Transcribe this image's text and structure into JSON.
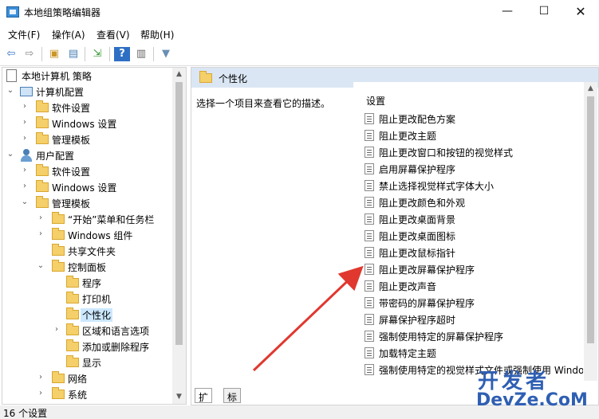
{
  "window": {
    "title": "本地组策略编辑器",
    "minimize": "—",
    "maximize": "☐",
    "close": "✕"
  },
  "menu": [
    "文件(F)",
    "操作(A)",
    "查看(V)",
    "帮助(H)"
  ],
  "toolbar": {
    "back": "⇦",
    "forward": "⇨",
    "up": "▣",
    "show_hide": "▤",
    "export": "⇲",
    "help": "?",
    "properties": "▥",
    "filter": "▼"
  },
  "tree": {
    "root": "本地计算机 策略",
    "computer_config": "计算机配置",
    "cc_software": "软件设置",
    "cc_windows": "Windows 设置",
    "cc_admin": "管理模板",
    "user_config": "用户配置",
    "uc_software": "软件设置",
    "uc_windows": "Windows 设置",
    "uc_admin": "管理模板",
    "start_menu": "“开始”菜单和任务栏",
    "windows_components": "Windows 组件",
    "shared_folders": "共享文件夹",
    "control_panel": "控制面板",
    "programs": "程序",
    "printers": "打印机",
    "personalization": "个性化",
    "region_language": "区域和语言选项",
    "add_remove": "添加或删除程序",
    "display": "显示",
    "network": "网络",
    "system": "系统"
  },
  "right": {
    "header": "个性化",
    "description": "选择一个项目来查看它的描述。",
    "settings_header": "设置",
    "settings": [
      "阻止更改配色方案",
      "阻止更改主题",
      "阻止更改窗口和按钮的视觉样式",
      "启用屏幕保护程序",
      "禁止选择视觉样式字体大小",
      "阻止更改颜色和外观",
      "阻止更改桌面背景",
      "阻止更改桌面图标",
      "阻止更改鼠标指针",
      "阻止更改屏幕保护程序",
      "阻止更改声音",
      "带密码的屏幕保护程序",
      "屏幕保护程序超时",
      "强制使用特定的屏幕保护程序",
      "加载特定主题",
      "强制使用特定的视觉样式文件或强制使用 Window"
    ],
    "tabs": [
      "扩展",
      "标准"
    ]
  },
  "status": "16 个设置",
  "watermark": {
    "cn": "开发者",
    "en": "DevZe.CoM"
  },
  "colors": {
    "arrow": "#e0382f",
    "selection": "#cce8ff",
    "header": "#dbe6f4",
    "watermark": "#2f5fb3"
  }
}
